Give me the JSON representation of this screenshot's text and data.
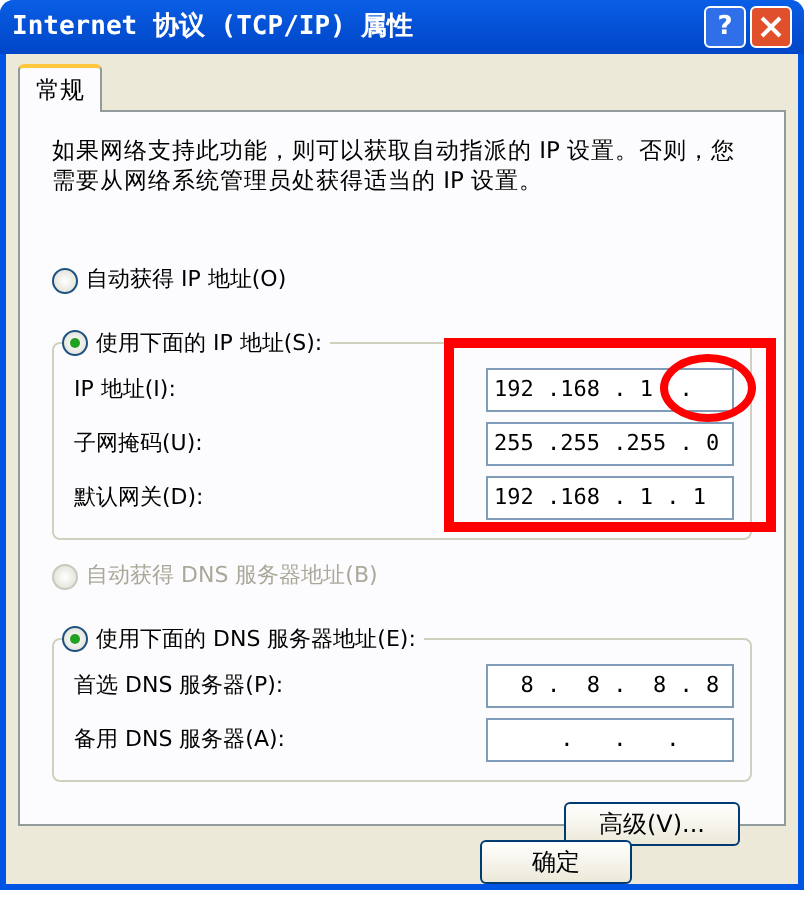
{
  "window": {
    "title": "Internet 协议 (TCP/IP) 属性",
    "help_button": "?"
  },
  "tabs": [
    {
      "label": "常规",
      "selected": true
    }
  ],
  "description": "如果网络支持此功能，则可以获取自动指派的 IP 设置。否则，您需要从网络系统管理员处获得适当的 IP 设置。",
  "ip_mode": [
    {
      "label": "自动获得 IP 地址(O)",
      "selected": false,
      "disabled": false
    },
    {
      "label": "使用下面的 IP 地址(S):",
      "selected": true,
      "disabled": false
    }
  ],
  "ip_fields": [
    {
      "label": "IP 地址(I):",
      "value": "192 .168 . 1  ."
    },
    {
      "label": "子网掩码(U):",
      "value": "255 .255 .255 . 0"
    },
    {
      "label": "默认网关(D):",
      "value": "192 .168 . 1 . 1"
    }
  ],
  "dns_mode": [
    {
      "label": "自动获得 DNS 服务器地址(B)",
      "selected": false,
      "disabled": true
    },
    {
      "label": "使用下面的 DNS 服务器地址(E):",
      "selected": true,
      "disabled": false
    }
  ],
  "dns_fields": [
    {
      "label": "首选 DNS 服务器(P):",
      "value": "  8 .  8 .  8 . 8"
    },
    {
      "label": "备用 DNS 服务器(A):",
      "value": "     .   .   ."
    }
  ],
  "buttons": [
    {
      "label": "高级(V)..."
    },
    {
      "label": "确定"
    }
  ],
  "annotations": {
    "rectangle": true,
    "circle": true
  }
}
